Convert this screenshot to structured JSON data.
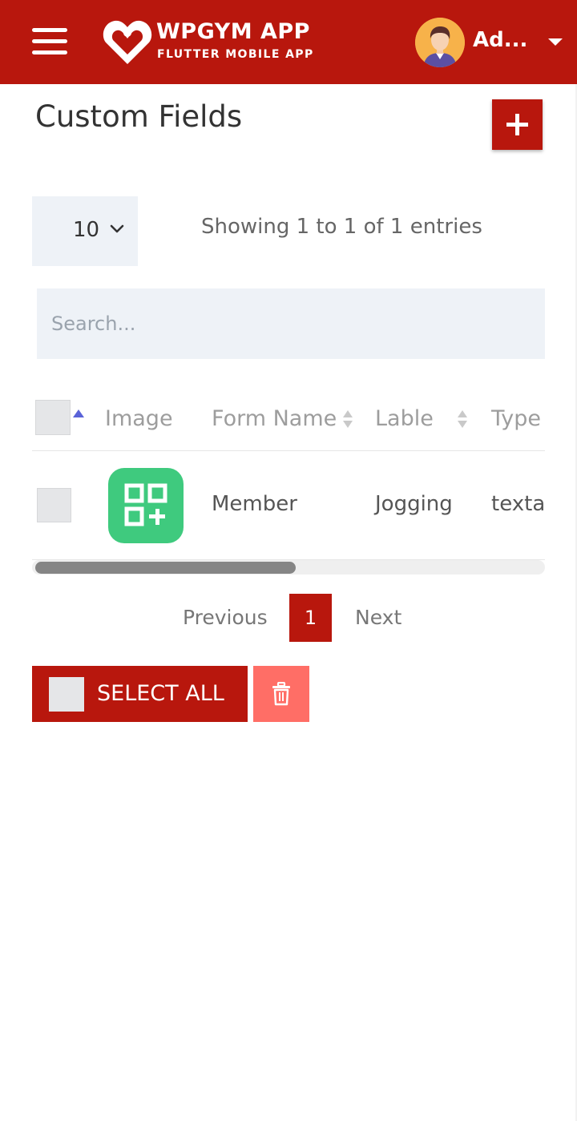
{
  "app": {
    "brand_title": "WPGYM APP",
    "brand_subtitle": "FLUTTER MOBILE APP",
    "user_name": "Ad...",
    "accent_color": "#b8170d"
  },
  "page": {
    "title": "Custom Fields"
  },
  "controls": {
    "page_length": "10",
    "entries_info": "Showing 1 to 1 of 1 entries",
    "search_placeholder": "Search..."
  },
  "table": {
    "columns": [
      "Image",
      "Form Name",
      "Lable",
      "Type"
    ],
    "rows": [
      {
        "image_icon": "qr-plus-icon",
        "form_name": "Member",
        "label": "Jogging",
        "type": "texta"
      }
    ]
  },
  "pagination": {
    "previous_label": "Previous",
    "current_page": "1",
    "next_label": "Next"
  },
  "bulk_actions": {
    "select_all_label": "SELECT ALL",
    "delete_icon": "trash-icon"
  }
}
